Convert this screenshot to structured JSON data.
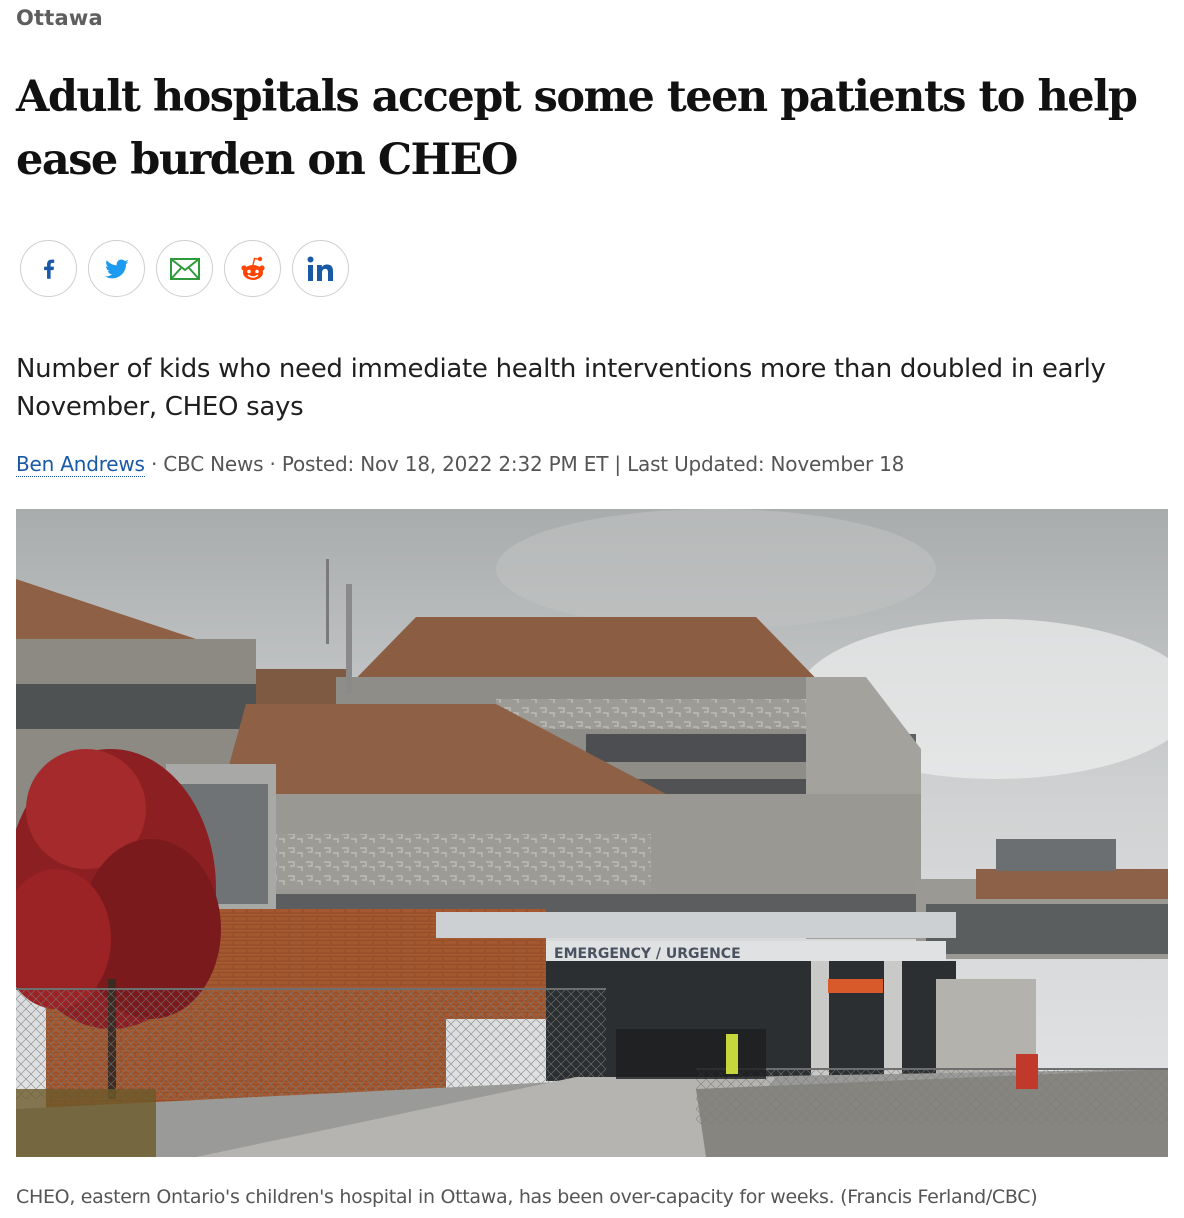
{
  "section": "Ottawa",
  "headline": "Adult hospitals accept some teen patients to help ease burden on CHEO",
  "share": [
    {
      "name": "facebook-share-button",
      "icon": "facebook-icon",
      "color": "#1a59a6"
    },
    {
      "name": "twitter-share-button",
      "icon": "twitter-icon",
      "color": "#1d9bf0"
    },
    {
      "name": "email-share-button",
      "icon": "email-icon",
      "color": "#2e9a3a"
    },
    {
      "name": "reddit-share-button",
      "icon": "reddit-icon",
      "color": "#ff4500"
    },
    {
      "name": "linkedin-share-button",
      "icon": "linkedin-icon",
      "color": "#1a59a6"
    }
  ],
  "deck": "Number of kids who need immediate health interventions more than doubled in early November, CHEO says",
  "byline": {
    "author": "Ben Andrews",
    "separator": " · ",
    "source": "CBC News",
    "posted": "Posted: Nov 18, 2022 2:32 PM ET",
    "divider": " | ",
    "updated": "Last Updated: November 18"
  },
  "photo": {
    "sign_text": "EMERGENCY / URGENCE"
  },
  "caption": "CHEO, eastern Ontario's children's hospital in Ottawa, has been over-capacity for weeks. (Francis Ferland/CBC)"
}
